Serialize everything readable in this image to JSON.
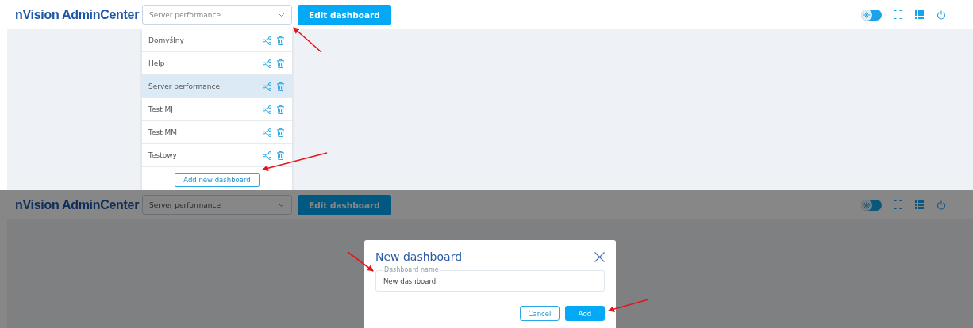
{
  "panels": [
    {
      "header": {
        "brand": "nVision AdminCenter",
        "select": {
          "value": "Server performance"
        },
        "edit_button": "Edit dashboard",
        "theme_switch": {
          "on": true
        }
      },
      "dropdown": {
        "items": [
          {
            "label": "Domyślny",
            "selected": false
          },
          {
            "label": "Help",
            "selected": false
          },
          {
            "label": "Server performance",
            "selected": true
          },
          {
            "label": "Test MJ",
            "selected": false
          },
          {
            "label": "Test MM",
            "selected": false
          },
          {
            "label": "Testowy",
            "selected": false
          }
        ],
        "add_button": "Add new dashboard"
      }
    },
    {
      "header": {
        "brand": "nVision AdminCenter",
        "select": {
          "value": "Server performance"
        },
        "edit_button": "Edit dashboard",
        "theme_switch": {
          "on": true
        }
      },
      "dialog": {
        "title": "New dashboard",
        "field": {
          "label": "Dashboard name",
          "value": "New dashboard"
        },
        "buttons": [
          {
            "label": "Cancel",
            "kind": "secondary"
          },
          {
            "label": "Add",
            "kind": "primary"
          }
        ]
      }
    }
  ]
}
